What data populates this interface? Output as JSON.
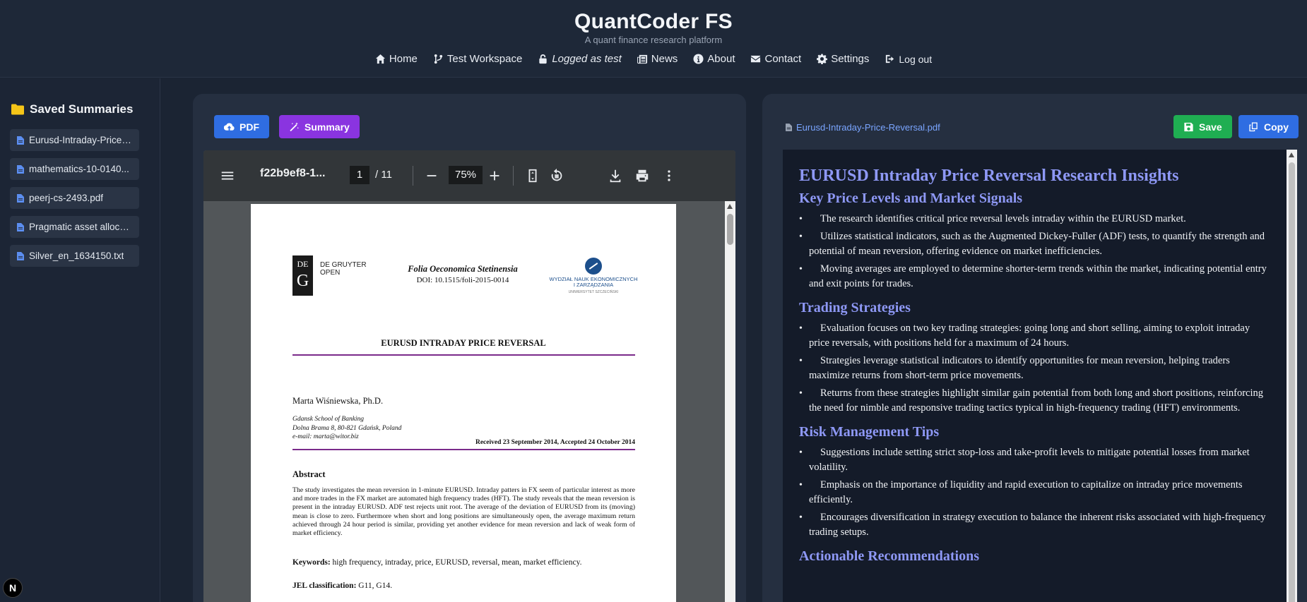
{
  "header": {
    "brand": "QuantCoder FS",
    "tagline": "A quant finance research platform",
    "nav": [
      {
        "label": "Home",
        "icon": "home-icon"
      },
      {
        "label": "Test Workspace",
        "icon": "branch-icon"
      },
      {
        "label": "Logged as test",
        "icon": "lock-icon"
      },
      {
        "label": "News",
        "icon": "newspaper-icon"
      },
      {
        "label": "About",
        "icon": "info-icon"
      },
      {
        "label": "Contact",
        "icon": "envelope-icon"
      },
      {
        "label": "Settings",
        "icon": "gear-icon"
      },
      {
        "label": "Log out",
        "icon": "logout-icon"
      }
    ]
  },
  "sidebar": {
    "title": "Saved Summaries",
    "items": [
      "Eurusd-Intraday-Price-...",
      "mathematics-10-0140...",
      "peerj-cs-2493.pdf",
      "Pragmatic asset allocat...",
      "Silver_en_1634150.txt"
    ]
  },
  "left": {
    "pdf_button": "PDF",
    "summary_button": "Summary",
    "viewer": {
      "title": "f22b9ef8-1...",
      "page": "1",
      "total_pages": "/ 11",
      "zoom": "75%"
    },
    "doc": {
      "publisher_line1": "DE GRUYTER",
      "publisher_line2": "OPEN",
      "logo_top": "DE",
      "logo_bottom": "G",
      "journal": "Folia Oeconomica Stetinensia",
      "doi": "DOI: 10.1515/foli-2015-0014",
      "faculty_line1": "WYDZIAŁ NAUK EKONOMICZNYCH",
      "faculty_line2": "I ZARZĄDZANIA",
      "faculty_line3": "UNIWERSYTET SZCZECIŃSKI",
      "title": "EURUSD INTRADAY PRICE REVERSAL",
      "author": "Marta Wiśniewska, Ph.D.",
      "affil1": "Gdansk School of Banking",
      "affil2": "Dolna Brama 8, 80-821 Gdańsk, Poland",
      "affil3": "e-mail: marta@witor.biz",
      "received": "Received 23 September 2014, Accepted 24 October 2014",
      "abstract_heading": "Abstract",
      "abstract": "The study investigates the mean reversion in 1-minute EURUSD. Intraday patters in FX seem of particular interest as more and more trades in the FX market are automated high frequency trades (HFT). The study reveals that the mean reversion is present in the intraday EURUSD. ADF test rejects unit root. The average of the deviation of EURUSD from its (moving) mean is close to zero. Furthermore when short and long positions are simultaneously open, the average maximum return achieved through 24 hour period is similar, providing yet another evidence for mean reversion and lack of weak form of market efficiency.",
      "keywords_label": "Keywords:",
      "keywords": "high frequency, intraday, price, EURUSD, reversal, mean, market efficiency.",
      "jel_label": "JEL classification:",
      "jel": "G11, G14."
    }
  },
  "right": {
    "file_name": "Eurusd-Intraday-Price-Reversal.pdf",
    "save_button": "Save",
    "copy_button": "Copy",
    "summary": {
      "title": "EURUSD Intraday Price Reversal Research Insights",
      "sections": [
        {
          "heading": "Key Price Levels and Market Signals",
          "bullets": [
            "The research identifies critical price reversal levels intraday within the EURUSD market.",
            "Utilizes statistical indicators, such as the Augmented Dickey-Fuller (ADF) tests, to quantify the strength and potential of mean reversion, offering evidence on market inefficiencies.",
            "Moving averages are employed to determine shorter-term trends within the market, indicating potential entry and exit points for trades."
          ]
        },
        {
          "heading": "Trading Strategies",
          "bullets": [
            "Evaluation focuses on two key trading strategies: going long and short selling, aiming to exploit intraday price reversals, with positions held for a maximum of 24 hours.",
            "Strategies leverage statistical indicators to identify opportunities for mean reversion, helping traders maximize returns from short-term price movements.",
            "Returns from these strategies highlight similar gain potential from both long and short positions, reinforcing the need for nimble and responsive trading tactics typical in high-frequency trading (HFT) environments."
          ]
        },
        {
          "heading": "Risk Management Tips",
          "bullets": [
            "Suggestions include setting strict stop-loss and take-profit levels to mitigate potential losses from market volatility.",
            "Emphasis on the importance of liquidity and rapid execution to capitalize on intraday price movements efficiently.",
            "Encourages diversification in strategy execution to balance the inherent risks associated with high-frequency trading setups."
          ]
        },
        {
          "heading": "Actionable Recommendations",
          "bullets": []
        }
      ]
    }
  },
  "badge": "N"
}
